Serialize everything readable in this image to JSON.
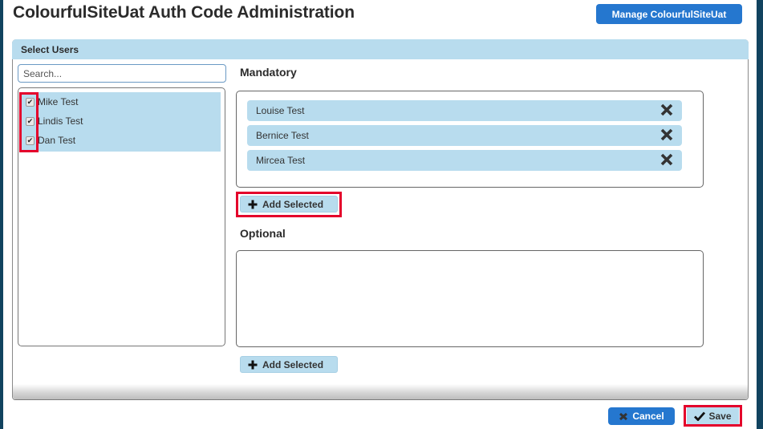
{
  "header": {
    "title": "ColourfulSiteUat Auth Code Administration",
    "manage_button": "Manage ColourfulSiteUat"
  },
  "panel": {
    "title": "Select Users"
  },
  "search": {
    "placeholder": "Search...",
    "value": ""
  },
  "users": [
    {
      "name": "Mike Test",
      "checked": true
    },
    {
      "name": "Lindis Test",
      "checked": true
    },
    {
      "name": "Dan Test",
      "checked": true
    }
  ],
  "mandatory": {
    "label": "Mandatory",
    "members": [
      {
        "name": "Louise Test"
      },
      {
        "name": "Bernice Test"
      },
      {
        "name": "Mircea Test"
      }
    ],
    "add_button": "Add Selected"
  },
  "optional": {
    "label": "Optional",
    "members": [],
    "add_button": "Add Selected"
  },
  "actions": {
    "cancel": "Cancel",
    "save": "Save"
  },
  "icons": {
    "checkbox_check": "check-icon",
    "remove": "close-icon",
    "add": "plus-icon",
    "cancel": "cancel-icon",
    "save": "check-icon"
  },
  "colors": {
    "accent_blue": "#2577cf",
    "light_blue": "#b8dcee",
    "dark_strip": "#11435f",
    "highlight_red": "#e4002b"
  }
}
